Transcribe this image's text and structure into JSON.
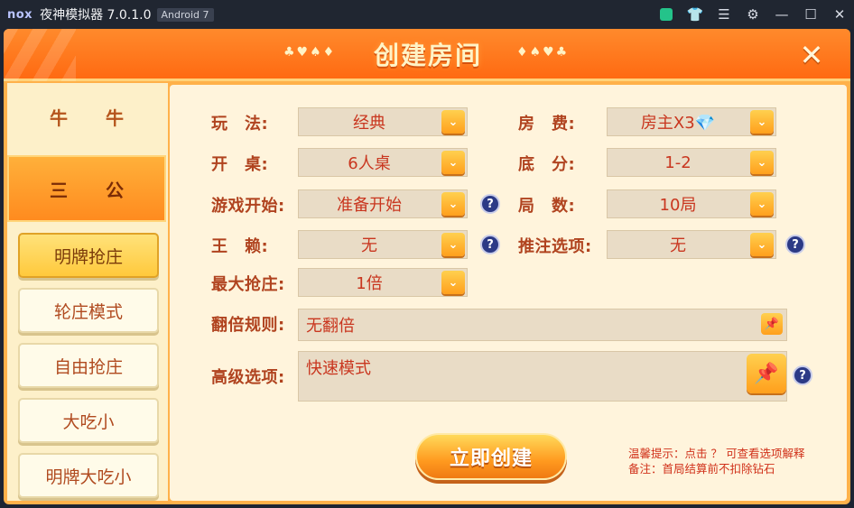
{
  "emulator": {
    "logo": "nox",
    "title": "夜神模拟器 7.0.1.0",
    "android_badge": "Android 7",
    "icons": [
      "store-icon",
      "shirt-icon",
      "menu-icon",
      "gear-icon",
      "minimize-icon",
      "maximize-icon",
      "close-icon"
    ]
  },
  "header": {
    "title": "创建房间",
    "suits_left": "♣♥♠♦",
    "suits_right": "♦♠♥♣",
    "close_icon": "crossed-swords-icon"
  },
  "game_tabs": [
    {
      "chars": [
        "牛",
        "牛"
      ]
    },
    {
      "chars": [
        "三",
        "公"
      ],
      "active": true
    }
  ],
  "modes": [
    {
      "label": "明牌抢庄",
      "active": true
    },
    {
      "label": "轮庄模式"
    },
    {
      "label": "自由抢庄"
    },
    {
      "label": "大吃小"
    },
    {
      "label": "明牌大吃小"
    }
  ],
  "settings": {
    "play": {
      "label": "玩　法:",
      "value": "经典"
    },
    "fee": {
      "label": "房　费:",
      "value": "房主X3💎"
    },
    "table": {
      "label": "开　桌:",
      "value": "6人桌"
    },
    "base": {
      "label": "底　分:",
      "value": "1-2"
    },
    "start": {
      "label": "游戏开始:",
      "value": "准备开始"
    },
    "rounds": {
      "label": "局　数:",
      "value": "10局"
    },
    "wild": {
      "label": "王　赖:",
      "value": "无"
    },
    "push": {
      "label": "推注选项:",
      "value": "无"
    },
    "max_bid": {
      "label": "最大抢庄:",
      "value": "1倍"
    },
    "double_rule": {
      "label": "翻倍规则:",
      "value": "无翻倍"
    },
    "advanced": {
      "label": "高级选项:",
      "value": "快速模式"
    }
  },
  "help_glyph": "?",
  "dropdown_glyph": "⌄",
  "create_button": "立即创建",
  "tips": {
    "line1": "温馨提示：点击 ？ 可查看选项解释",
    "line2": "备注：首局结算前不扣除钻石"
  },
  "colors": {
    "accent": "#ff8a1e",
    "text": "#c9361f",
    "label": "#b0431f"
  }
}
